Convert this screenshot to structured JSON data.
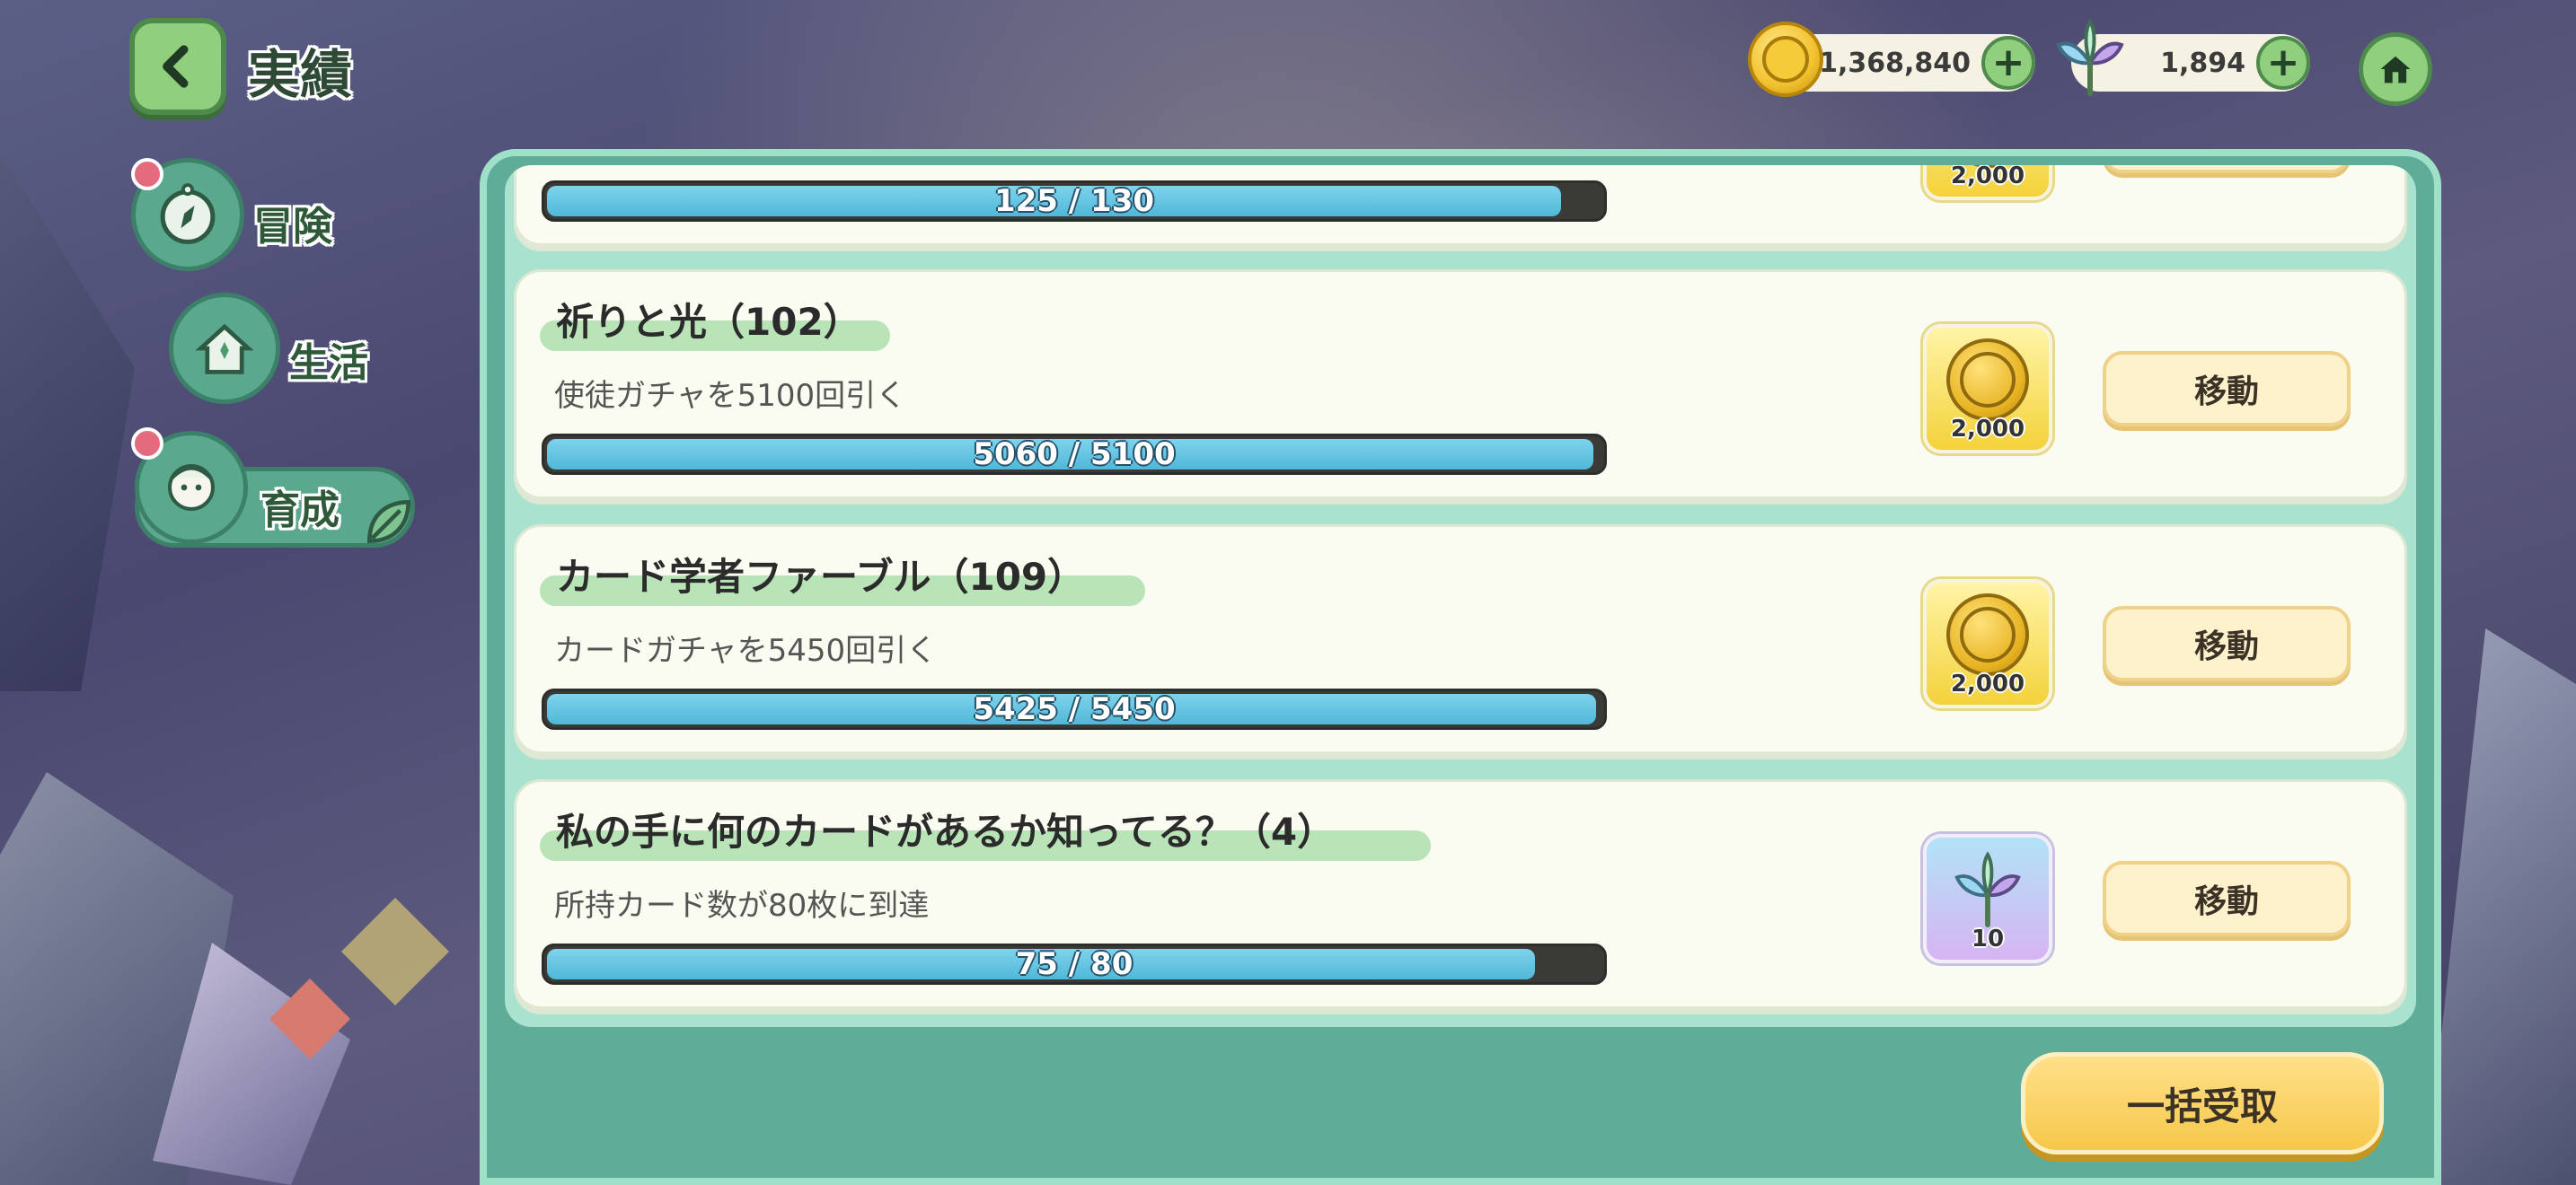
{
  "header": {
    "title": "実績",
    "coins": "1,368,840",
    "crystals": "1,894"
  },
  "nav": {
    "items": [
      {
        "label": "冒険",
        "badge": true
      },
      {
        "label": "生活",
        "badge": false
      },
      {
        "label": "育成",
        "badge": true,
        "active": true
      }
    ]
  },
  "achievements": [
    {
      "title": "",
      "description": "",
      "progress": "125 / 130",
      "progress_fraction": 0.962,
      "reward_type": "coin",
      "reward_amount": "2,000",
      "button": ""
    },
    {
      "title": "祈りと光（102）",
      "description": "使徒ガチャを5100回引く",
      "progress": "5060 / 5100",
      "progress_fraction": 0.992,
      "reward_type": "coin",
      "reward_amount": "2,000",
      "button": "移動"
    },
    {
      "title": "カード学者ファーブル（109）",
      "description": "カードガチャを5450回引く",
      "progress": "5425 / 5450",
      "progress_fraction": 0.995,
      "reward_type": "coin",
      "reward_amount": "2,000",
      "button": "移動"
    },
    {
      "title": "私の手に何のカードがあるか知ってる？（4）",
      "description": "所持カード数が80枚に到達",
      "progress": "75 / 80",
      "progress_fraction": 0.9375,
      "reward_type": "crystal",
      "reward_amount": "10",
      "button": "移動"
    }
  ],
  "footer": {
    "claim_all": "一括受取"
  },
  "colors": {
    "panel": "#5fac98",
    "accent_green": "#8fcf7d",
    "progress_fill": "#4fb8d8",
    "button": "#fdf2cc"
  }
}
